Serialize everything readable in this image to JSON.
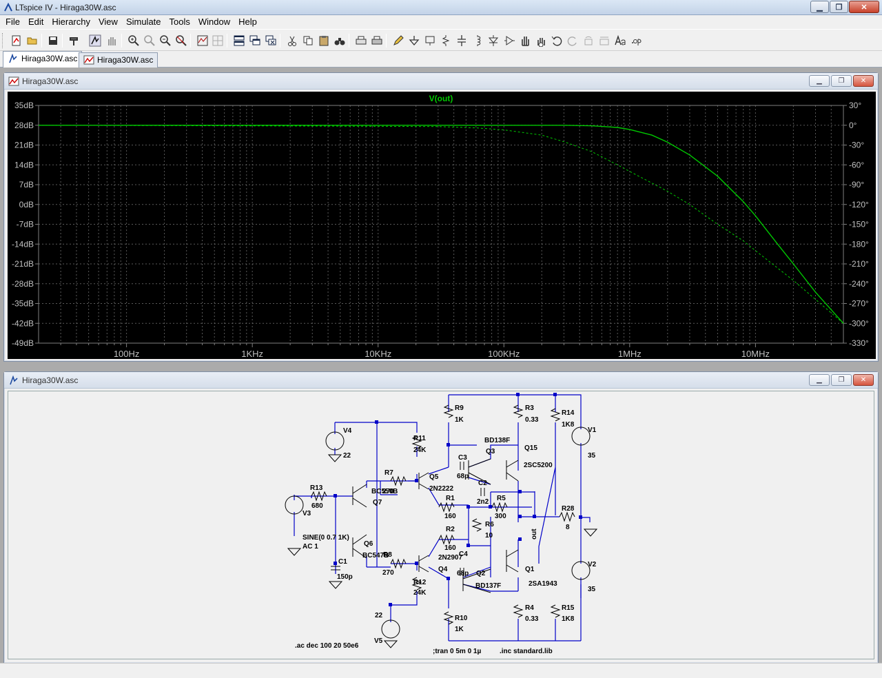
{
  "window": {
    "title": "LTspice IV - Hiraga30W.asc"
  },
  "menu": [
    "File",
    "Edit",
    "Hierarchy",
    "View",
    "Simulate",
    "Tools",
    "Window",
    "Help"
  ],
  "tabs": [
    {
      "label": "Hiraga30W.asc",
      "kind": "schematic",
      "active": true
    },
    {
      "label": "Hiraga30W.asc",
      "kind": "waveform",
      "active": false
    }
  ],
  "plot_window": {
    "title": "Hiraga30W.asc"
  },
  "schematic_window": {
    "title": "Hiraga30W.asc"
  },
  "chart_data": {
    "type": "line",
    "title": "V(out)",
    "colors": {
      "trace": "#00c800",
      "background": "#000000",
      "axis": "#808080",
      "text": "#c0c0c0"
    },
    "x_scale": "log",
    "x_range_hz": [
      20,
      50000000
    ],
    "x_tick_labels": [
      {
        "hz": 100,
        "label": "100Hz"
      },
      {
        "hz": 1000,
        "label": "1KHz"
      },
      {
        "hz": 10000,
        "label": "10KHz"
      },
      {
        "hz": 100000,
        "label": "100KHz"
      },
      {
        "hz": 1000000,
        "label": "1MHz"
      },
      {
        "hz": 10000000,
        "label": "10MHz"
      }
    ],
    "y_left_range_db": [
      -49,
      35
    ],
    "y_left_labels": [
      "35dB",
      "28dB",
      "21dB",
      "14dB",
      "7dB",
      "0dB",
      "-7dB",
      "-14dB",
      "-21dB",
      "-28dB",
      "-35dB",
      "-42dB",
      "-49dB"
    ],
    "y_right_range_deg": [
      -330,
      30
    ],
    "y_right_labels": [
      "30°",
      "0°",
      "-30°",
      "-60°",
      "-90°",
      "-120°",
      "-150°",
      "-180°",
      "-210°",
      "-240°",
      "-270°",
      "-300°",
      "-330°"
    ],
    "grid": true,
    "series": [
      {
        "name": "V(out)",
        "quantity": "magnitude",
        "style": "solid",
        "x": [
          20,
          1000,
          100000,
          300000,
          500000,
          800000,
          1000000,
          1500000,
          2000000,
          3000000,
          5000000,
          8000000,
          10000000,
          15000000,
          20000000,
          30000000,
          50000000
        ],
        "y": [
          28,
          28,
          28,
          28,
          27.8,
          27.2,
          26.5,
          24.5,
          22,
          17.5,
          10,
          1,
          -4,
          -14,
          -21,
          -31,
          -42
        ]
      },
      {
        "name": "V(out) phase",
        "quantity": "phase",
        "style": "dashed",
        "x": [
          20,
          1000,
          30000,
          60000,
          100000,
          200000,
          300000,
          500000,
          800000,
          1000000,
          2000000,
          3000000,
          5000000,
          8000000,
          10000000,
          20000000,
          50000000
        ],
        "y": [
          0,
          -1,
          -2,
          -4,
          -7,
          -15,
          -25,
          -40,
          -60,
          -70,
          -100,
          -120,
          -150,
          -175,
          -190,
          -235,
          -300
        ]
      }
    ]
  },
  "schematic": {
    "components": [
      {
        "ref": "V4",
        "value": "22"
      },
      {
        "ref": "V1",
        "value": "35"
      },
      {
        "ref": "V2",
        "value": "35"
      },
      {
        "ref": "V3",
        "value": "SINE(0 0.7 1K)",
        "ac": "AC 1"
      },
      {
        "ref": "V5",
        "value": "22"
      },
      {
        "ref": "R13",
        "value": "680"
      },
      {
        "ref": "R11",
        "value": "24K"
      },
      {
        "ref": "R12",
        "value": "24K"
      },
      {
        "ref": "R7",
        "value": "270"
      },
      {
        "ref": "R8",
        "value": "270"
      },
      {
        "ref": "R9",
        "value": "1K"
      },
      {
        "ref": "R10",
        "value": "1K"
      },
      {
        "ref": "R3",
        "value": "0.33"
      },
      {
        "ref": "R4",
        "value": "0.33"
      },
      {
        "ref": "R14",
        "value": "1K8"
      },
      {
        "ref": "R15",
        "value": "1K8"
      },
      {
        "ref": "R1",
        "value": "160"
      },
      {
        "ref": "R2",
        "value": "160"
      },
      {
        "ref": "R5",
        "value": "300"
      },
      {
        "ref": "R6",
        "value": "10"
      },
      {
        "ref": "R28",
        "value": "8"
      },
      {
        "ref": "C1",
        "value": "150p"
      },
      {
        "ref": "C2",
        "value": "2n2"
      },
      {
        "ref": "C3",
        "value": "68p"
      },
      {
        "ref": "C4",
        "value": "68p"
      },
      {
        "ref": "Q7",
        "value": "BC550B"
      },
      {
        "ref": "Q6",
        "value": "BC547B"
      },
      {
        "ref": "Q5",
        "value": "2N2222"
      },
      {
        "ref": "Q4",
        "value": "2N2907"
      },
      {
        "ref": "Q3",
        "value": "BD138F"
      },
      {
        "ref": "Q2",
        "value": "BD137F"
      },
      {
        "ref": "Q15",
        "value": "2SC5200"
      },
      {
        "ref": "Q1",
        "value": "2SA1943"
      }
    ],
    "net_label": "out",
    "directives": [
      ".ac dec 100 20 50e6",
      ";tran 0 5m 0 1µ",
      ".inc standard.lib"
    ]
  }
}
